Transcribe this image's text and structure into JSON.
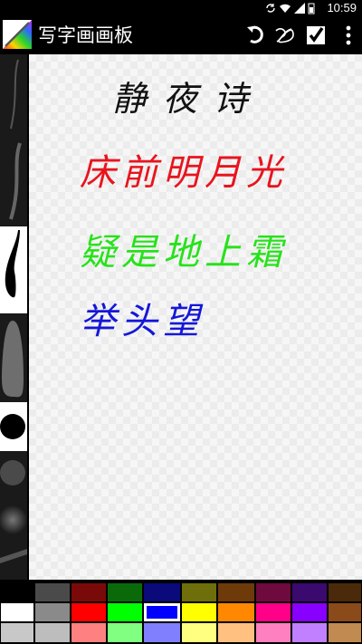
{
  "status_bar": {
    "time": "10:59"
  },
  "action_bar": {
    "title": "写字画画板",
    "icons": [
      "undo-icon",
      "clear-scribble-icon",
      "confirm-check-icon",
      "overflow-menu-icon"
    ]
  },
  "poem": {
    "title": "静夜诗",
    "lines": [
      {
        "text": "床前明月光",
        "color": "#e8141e"
      },
      {
        "text": "疑是地上霜",
        "color": "#27e21b"
      },
      {
        "text": "举头望",
        "color": "#1417d8"
      }
    ],
    "title_color": "#111111"
  },
  "palette": {
    "rows": [
      [
        "#000000",
        "#4a4a4a",
        "#7a0a0a",
        "#0a6a0a",
        "#0a0a7a",
        "#6e6e0a",
        "#6e3a0a",
        "#6e0a3e",
        "#3a0a6e",
        "#4a2a0a"
      ],
      [
        "#ffffff",
        "#8a8a8a",
        "#ff0000",
        "#00ff00",
        "#0000ff",
        "#ffff00",
        "#ff8800",
        "#ff0088",
        "#8800ff",
        "#8a4a1a"
      ],
      [
        "#c8c8c8",
        "#bdbdbd",
        "#ff8080",
        "#80ff80",
        "#8080ff",
        "#ffff80",
        "#ffc080",
        "#ff80c0",
        "#c080ff",
        "#c08a50"
      ]
    ],
    "selected": {
      "row": 1,
      "col": 4
    }
  }
}
